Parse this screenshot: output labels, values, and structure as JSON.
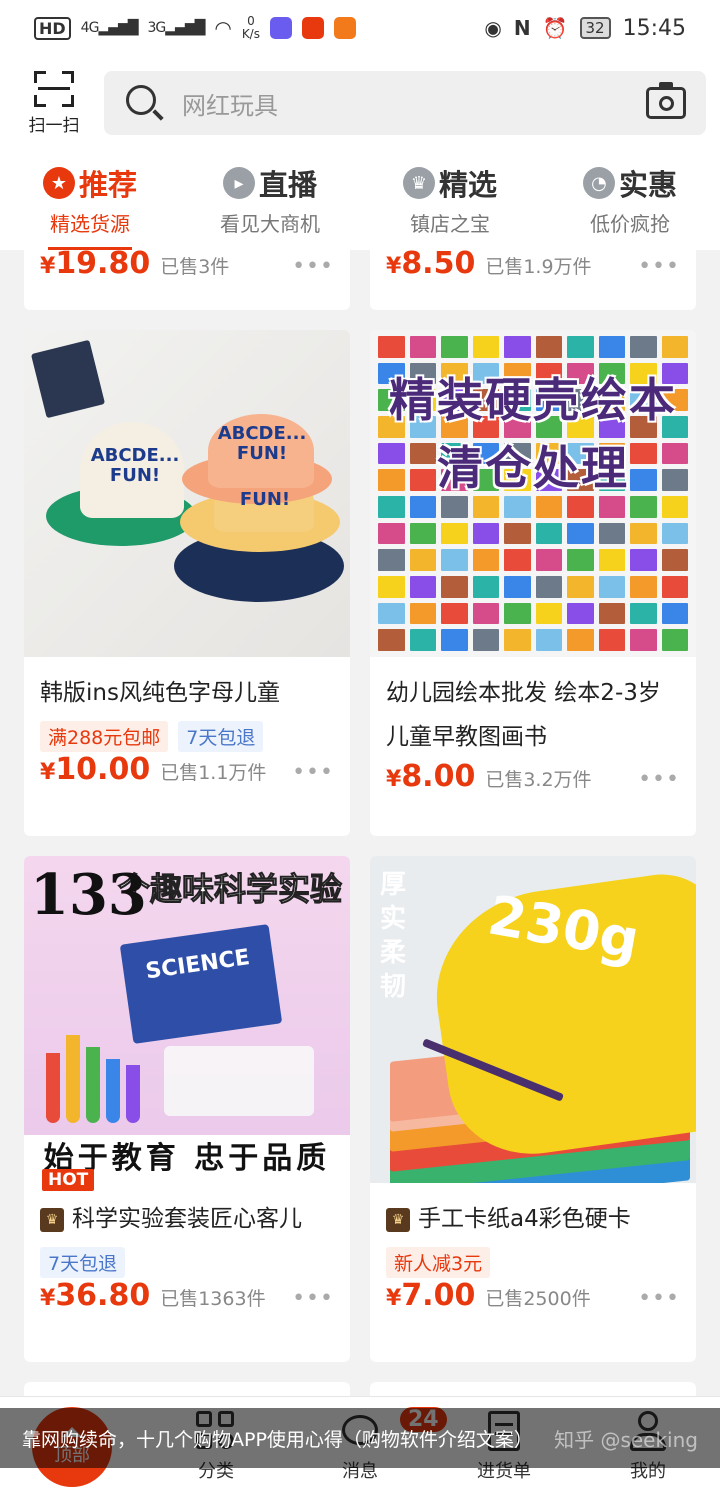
{
  "status_bar": {
    "hd": "HD",
    "net1": "4G",
    "net2": "3G",
    "speed_value": "0",
    "speed_unit": "K/s",
    "battery": "32",
    "time": "15:45",
    "app_colors": [
      "#6b5cf0",
      "#e8380d",
      "#f27a1a"
    ]
  },
  "header": {
    "scan_label": "扫一扫",
    "search_placeholder": "网红玩具"
  },
  "tabs": [
    {
      "title": "推荐",
      "sub": "精选货源",
      "icon": "star-icon",
      "active": true
    },
    {
      "title": "直播",
      "sub": "看见大商机",
      "icon": "live-icon",
      "active": false
    },
    {
      "title": "精选",
      "sub": "镇店之宝",
      "icon": "crown-icon",
      "active": false
    },
    {
      "title": "实惠",
      "sub": "低价疯抢",
      "icon": "tag-icon",
      "active": false
    }
  ],
  "partial_row": [
    {
      "yen": "¥",
      "price": "19.80",
      "sold": "已售3件"
    },
    {
      "yen": "¥",
      "price": "8.50",
      "sold": "已售1.9万件"
    }
  ],
  "products": [
    {
      "title": "韩版ins风纯色字母儿童",
      "tags": [
        {
          "text": "满288元包邮",
          "style": "red"
        },
        {
          "text": "7天包退",
          "style": "blue"
        }
      ],
      "yen": "¥",
      "price": "10.00",
      "sold": "已售1.1万件",
      "image": {
        "hat_text": "ABCDE... FUN!",
        "hat_text2": "FUN!"
      }
    },
    {
      "title": "幼儿园绘本批发 绘本2-3岁儿童早教图画书",
      "tags": [],
      "yen": "¥",
      "price": "8.00",
      "sold": "已售3.2万件",
      "image": {
        "line1": "精装硬壳绘本",
        "line2": "清仓处理"
      }
    },
    {
      "title": "科学实验套装匠心客儿",
      "tags": [
        {
          "text": "7天包退",
          "style": "blue"
        }
      ],
      "yen": "¥",
      "price": "36.80",
      "sold": "已售1363件",
      "hot": "HOT",
      "image": {
        "num": "133",
        "banner": "个趣味科学实验",
        "box": "SCIENCE",
        "bottom": "始于教育 忠于品质"
      }
    },
    {
      "title": "手工卡纸a4彩色硬卡",
      "tags": [
        {
          "text": "新人减3元",
          "style": "red"
        }
      ],
      "yen": "¥",
      "price": "7.00",
      "sold": "已售2500件",
      "image": {
        "big": "230g",
        "side": "厚实柔韧"
      }
    }
  ],
  "more_dots": "•••",
  "bottom_nav": {
    "top_label": "顶部",
    "items": [
      {
        "label": "分类"
      },
      {
        "label": "消息",
        "badge": "24"
      },
      {
        "label": "进货单"
      },
      {
        "label": "我的"
      }
    ]
  },
  "caption": {
    "text": "靠网购续命，十几个购物APP使用心得（购物软件介绍文案）",
    "watermark": "知乎 @seeking"
  },
  "colors": {
    "accent": "#e8380d",
    "tag_blue": "#4a77c9"
  }
}
